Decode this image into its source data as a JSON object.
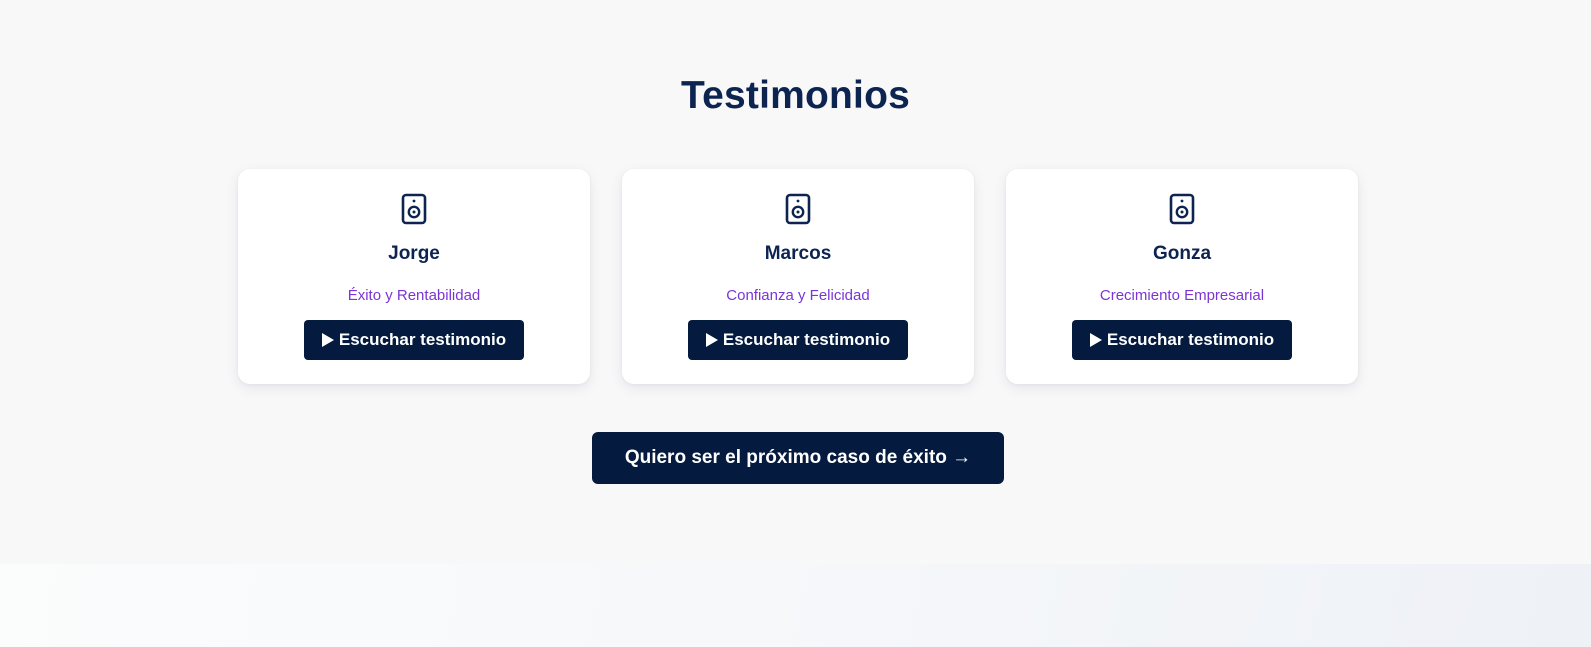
{
  "section": {
    "title": "Testimonios"
  },
  "testimonials": [
    {
      "name": "Jorge",
      "tag": "Éxito y Rentabilidad",
      "icon": "speaker-icon",
      "button_label": "Escuchar testimonio"
    },
    {
      "name": "Marcos",
      "tag": "Confianza y Felicidad",
      "icon": "speaker-icon",
      "button_label": "Escuchar testimonio"
    },
    {
      "name": "Gonza",
      "tag": "Crecimiento Empresarial",
      "icon": "speaker-icon",
      "button_label": "Escuchar testimonio"
    }
  ],
  "cta": {
    "label": "Quiero ser el próximo caso de éxito →"
  },
  "colors": {
    "navy": "#041a3e",
    "title": "#0d2350",
    "accent_purple": "#7b35d6",
    "background": "#f8f8f9"
  }
}
